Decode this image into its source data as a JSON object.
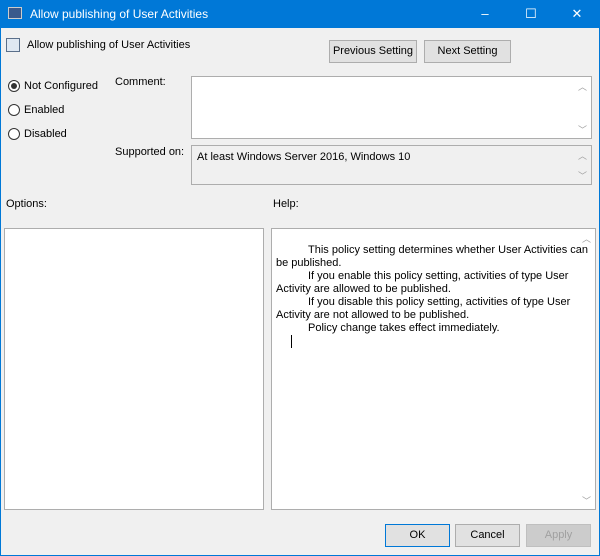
{
  "window": {
    "title": "Allow publishing of User Activities",
    "minimize": "–",
    "maximize": "☐",
    "close": "✕"
  },
  "header": {
    "title": "Allow publishing of User Activities",
    "prev": "Previous Setting",
    "next": "Next Setting"
  },
  "state": {
    "options": [
      {
        "label": "Not Configured",
        "selected": true
      },
      {
        "label": "Enabled",
        "selected": false
      },
      {
        "label": "Disabled",
        "selected": false
      }
    ]
  },
  "comment": {
    "label": "Comment:",
    "value": ""
  },
  "supported": {
    "label": "Supported on:",
    "value": "At least Windows Server 2016, Windows 10"
  },
  "options_label": "Options:",
  "help_label": "Help:",
  "help_lines": [
    "This policy setting determines whether User Activities can",
    "be published.",
    "If you enable this policy setting, activities of type User",
    "Activity are allowed to be published.",
    "If you disable this policy setting, activities of type User",
    "Activity are not allowed to be published.",
    "Policy change takes effect immediately."
  ],
  "footer": {
    "ok": "OK",
    "cancel": "Cancel",
    "apply": "Apply"
  }
}
